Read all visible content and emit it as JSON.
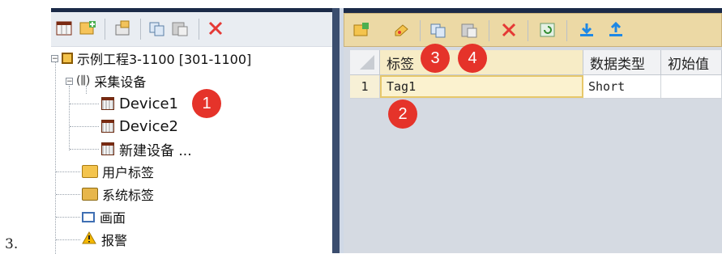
{
  "caption_number": "3.",
  "left_panel": {
    "tree": {
      "root": "示例工程3-1100 [301-1100]",
      "group": "采集设备",
      "devices": [
        "Device1",
        "Device2",
        "新建设备 ..."
      ],
      "items": [
        "用户标签",
        "系统标签",
        "画面",
        "报警"
      ]
    }
  },
  "right_panel": {
    "columns": [
      "标签",
      "数据类型",
      "初始值"
    ],
    "rows": [
      {
        "index": "1",
        "tag": "Tag1",
        "data_type": "Short",
        "initial": ""
      }
    ]
  },
  "badges": [
    "1",
    "2",
    "3",
    "4"
  ],
  "colors": {
    "accent_red": "#e5332a",
    "toolbar_highlight": "#ecd9a5",
    "selected_cell": "#fbf2cf",
    "header_dark": "#1b2a48"
  }
}
